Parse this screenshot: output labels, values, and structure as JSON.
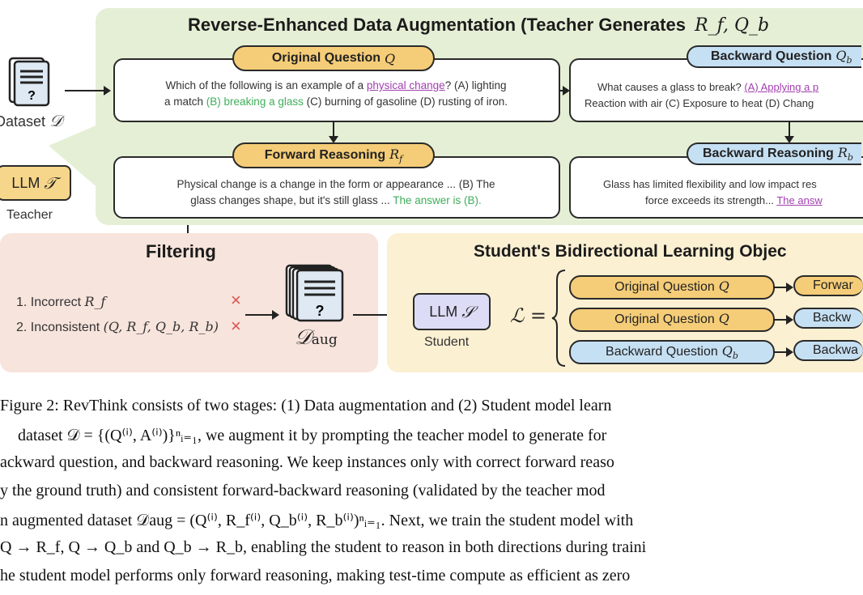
{
  "stage1": {
    "title": "Reverse-Enhanced Data Augmentation (Teacher Generates",
    "title_math": "R_f, Q_b",
    "original_question": {
      "label": "Original Question",
      "sym": "Q",
      "sub": ""
    },
    "original_text_1a": "Which of the following is an example of a ",
    "original_text_1b": "physical change",
    "original_text_1c": "? (A) lighting",
    "original_text_2a": "a match ",
    "original_text_2b": "(B) breaking a glass",
    "original_text_2c": " (C) burning of gasoline (D) rusting of iron.",
    "forward_reasoning": {
      "label": "Forward Reasoning",
      "sym": "R",
      "sub": "f"
    },
    "forward_text_1": "Physical change is a change in the form or appearance ... (B) The",
    "forward_text_2a": "glass changes shape, but it's still glass ... ",
    "forward_text_2b": "The answer is (B).",
    "backward_question": {
      "label": "Backward Question",
      "sym": "Q",
      "sub": "b"
    },
    "backward_text_1a": "What causes a glass to break? ",
    "backward_text_1b": "(A) Applying a p",
    "backward_text_2": "Reaction with air (C) Exposure to heat (D) Chang",
    "backward_reasoning": {
      "label": "Backward Reasoning",
      "sym": "R",
      "sub": "b"
    },
    "backward_reason_1": "Glass has limited flexibility and low impact res",
    "backward_reason_2a": "force exceeds its strength... ",
    "backward_reason_2b": "The answ"
  },
  "left": {
    "dataset_label": "Dataset",
    "dataset_sym": "𝒟",
    "teacher_llm": "LLM",
    "teacher_sym": "𝒯",
    "teacher_label": "Teacher"
  },
  "filtering": {
    "title": "Filtering",
    "items": [
      {
        "text": "1. Incorrect ",
        "math": "R_f"
      },
      {
        "text": "2. Inconsistent ",
        "math": "(Q, R_f, Q_b, R_b)"
      }
    ],
    "x_mark": "×",
    "aug_sym": "𝒟",
    "aug_sub": "aug"
  },
  "student": {
    "title": "Student's Bidirectional Learning Objec",
    "llm": "LLM",
    "llm_sym": "𝒮",
    "label": "Student",
    "loss": "ℒ =",
    "rows": [
      {
        "from": "Original Question",
        "from_sym": "Q",
        "from_sub": "",
        "to": "Forwar",
        "from_color": "orange",
        "to_color": "orange"
      },
      {
        "from": "Original Question",
        "from_sym": "Q",
        "from_sub": "",
        "to": "Backw",
        "from_color": "orange",
        "to_color": "blue"
      },
      {
        "from": "Backward Question",
        "from_sym": "Q",
        "from_sub": "b",
        "to": "Backwa",
        "from_color": "blue",
        "to_color": "blue"
      }
    ]
  },
  "caption": [
    "Figure 2: RevThink consists of two stages: (1) Data augmentation and (2) Student model learn",
    "dataset 𝒟 = {(Q⁽ⁱ⁾, A⁽ⁱ⁾)}ⁿᵢ₌₁, we augment it by prompting the teacher model to generate for",
    "ackward question, and backward reasoning. We keep instances only with correct forward reaso",
    "y the ground truth) and consistent forward-backward reasoning (validated by the teacher mod",
    "n augmented dataset 𝒟aug = (Q⁽ⁱ⁾, R_f⁽ⁱ⁾, Q_b⁽ⁱ⁾, R_b⁽ⁱ⁾)ⁿᵢ₌₁. Next, we train the student model with",
    "Q → R_f, Q → Q_b and Q_b → R_b, enabling the student to reason in both directions during traini",
    "he student model performs only forward reasoning, making test-time compute as efficient as zero"
  ],
  "colors": {
    "green_panel": "#e5efd6",
    "filter_panel": "#f7e4dc",
    "student_panel": "#fbf0d2",
    "orange": "#f5cd78",
    "blue": "#c6e0f3",
    "answer_green": "#3fae5a",
    "link_purple": "#a23fb0",
    "x_red": "#d9534f"
  }
}
